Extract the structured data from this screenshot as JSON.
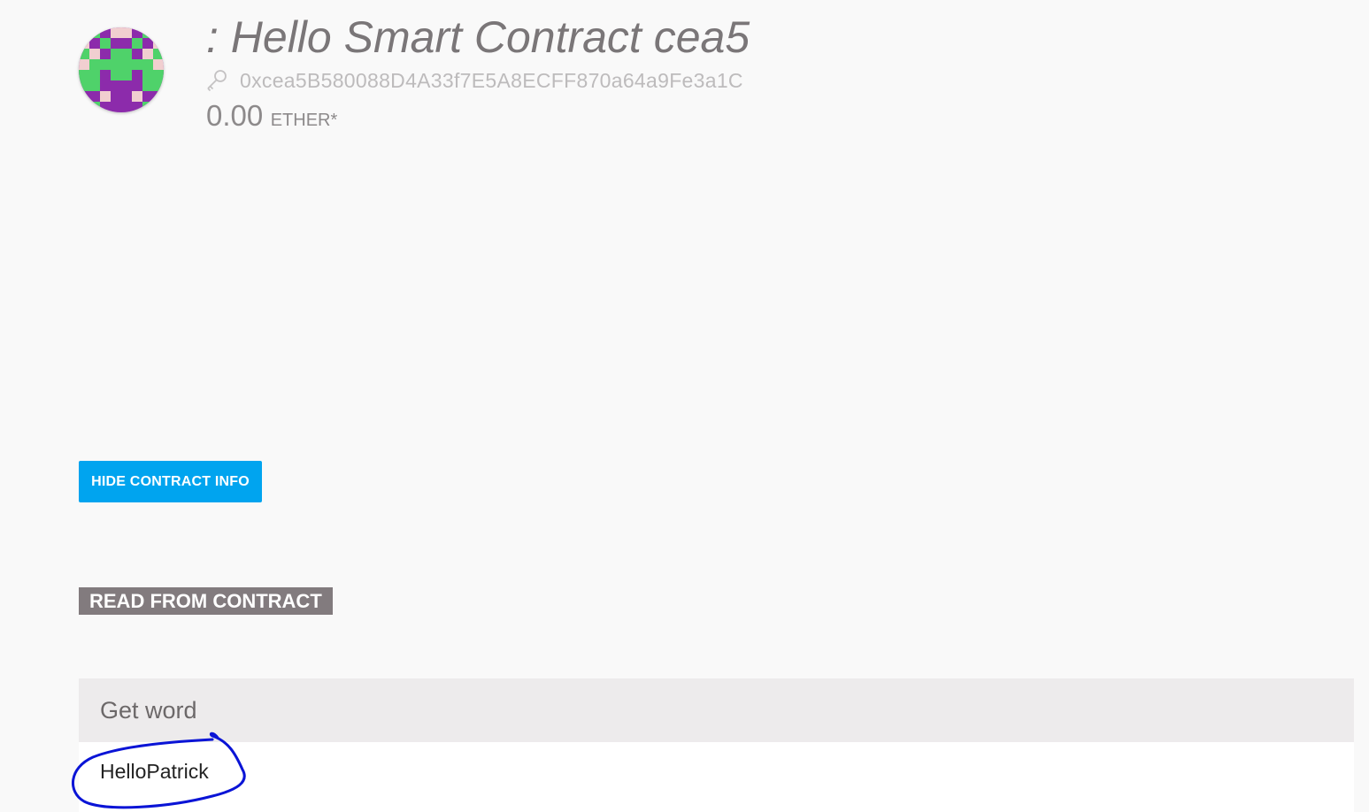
{
  "contract": {
    "title": ": Hello Smart Contract cea5",
    "address": "0xcea5B580088D4A33f7E5A8ECFF870a64a9Fe3a1C",
    "balance_value": "0.00",
    "balance_unit": "ETHER*",
    "avatar_icon": "identicon-avatar",
    "key_icon": "key-icon"
  },
  "actions": {
    "hide_info_label": "HIDE CONTRACT INFO"
  },
  "read_section": {
    "title": "READ FROM CONTRACT",
    "methods": [
      {
        "name": "Get word",
        "result": "HelloPatrick"
      }
    ]
  },
  "colors": {
    "button_blue": "#00a4ef",
    "section_header_bg": "#827b7e",
    "annotation_stroke": "#0a14d6",
    "identicon_purple": "#8c2bab",
    "identicon_green": "#4fd26a",
    "identicon_pink": "#f1cfd0"
  }
}
